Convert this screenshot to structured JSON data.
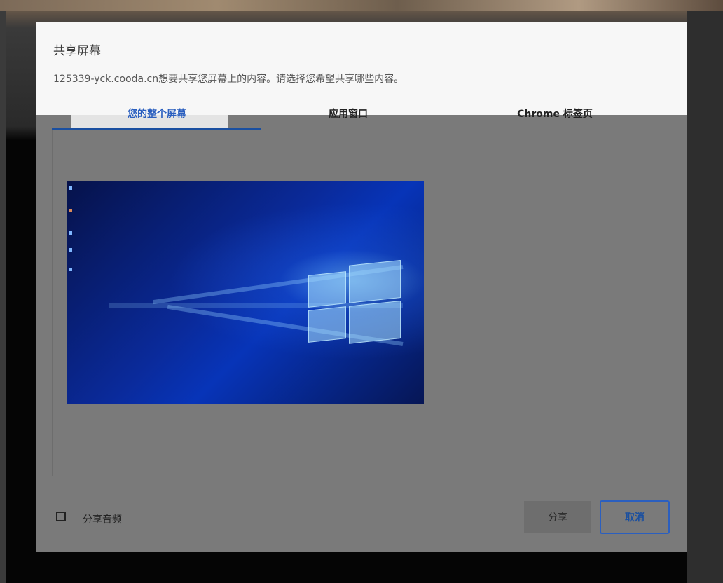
{
  "dialog": {
    "title": "共享屏幕",
    "subtitle": "125339-yck.cooda.cn想要共享您屏幕上的内容。请选择您希望共享哪些内容。"
  },
  "tabs": [
    {
      "label": "您的整个屏幕",
      "active": true
    },
    {
      "label": "应用窗口",
      "active": false
    },
    {
      "label": "Chrome 标签页",
      "active": false
    }
  ],
  "options": {
    "share_audio_label": "分享音频",
    "share_audio_checked": false
  },
  "buttons": {
    "share_label": "分享",
    "cancel_label": "取消"
  },
  "colors": {
    "accent": "#1a4fa0",
    "dialog_bg": "#f7f7f7",
    "overlay_dim": "#7a7a7a"
  }
}
